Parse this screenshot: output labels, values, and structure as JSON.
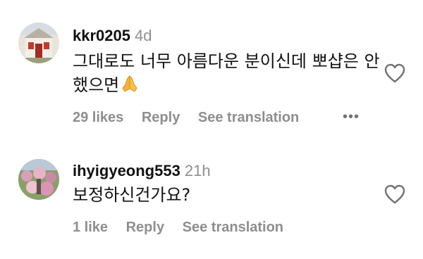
{
  "comments": [
    {
      "username": "kkr0205",
      "time": "4d",
      "text": "그대로도 너무 아름다운 분이신데 뽀샵은 안했으면",
      "emoji": "folded-hands-icon",
      "likes": "29 likes",
      "reply": "Reply",
      "translate": "See translation",
      "more": "•••"
    },
    {
      "username": "ihyigyeong553",
      "time": "21h",
      "text": "보정하신건가요?",
      "likes": "1 like",
      "reply": "Reply",
      "translate": "See translation"
    }
  ],
  "colors": {
    "text": "#111111",
    "muted": "#8e8e8e"
  }
}
